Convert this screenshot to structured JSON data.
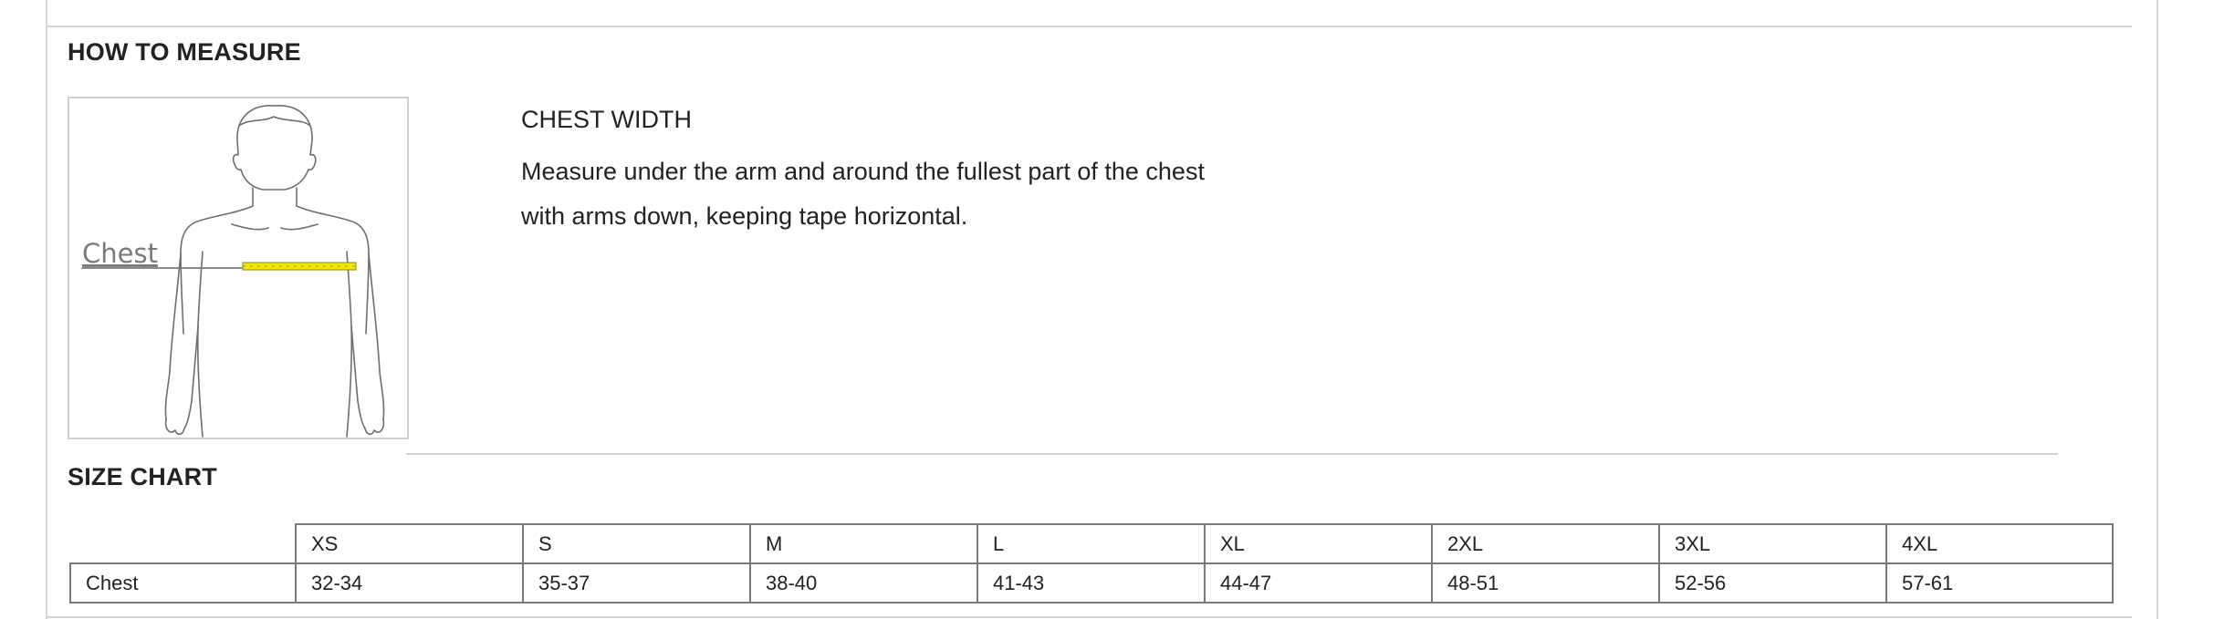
{
  "how_to_measure": {
    "title": "HOW TO MEASURE",
    "figure_label": "Chest",
    "measurement": {
      "heading": "CHEST WIDTH",
      "lines": [
        "Measure under the arm and around the fullest part of the chest",
        "with arms down, keeping tape horizontal."
      ]
    },
    "tape_color": "#f2e600"
  },
  "size_chart": {
    "title": "SIZE CHART",
    "sizes": [
      "XS",
      "S",
      "M",
      "L",
      "XL",
      "2XL",
      "3XL",
      "4XL"
    ],
    "rows": [
      {
        "label": "Chest",
        "values": [
          "32-34",
          "35-37",
          "38-40",
          "41-43",
          "44-47",
          "48-51",
          "52-56",
          "57-61"
        ]
      }
    ]
  }
}
